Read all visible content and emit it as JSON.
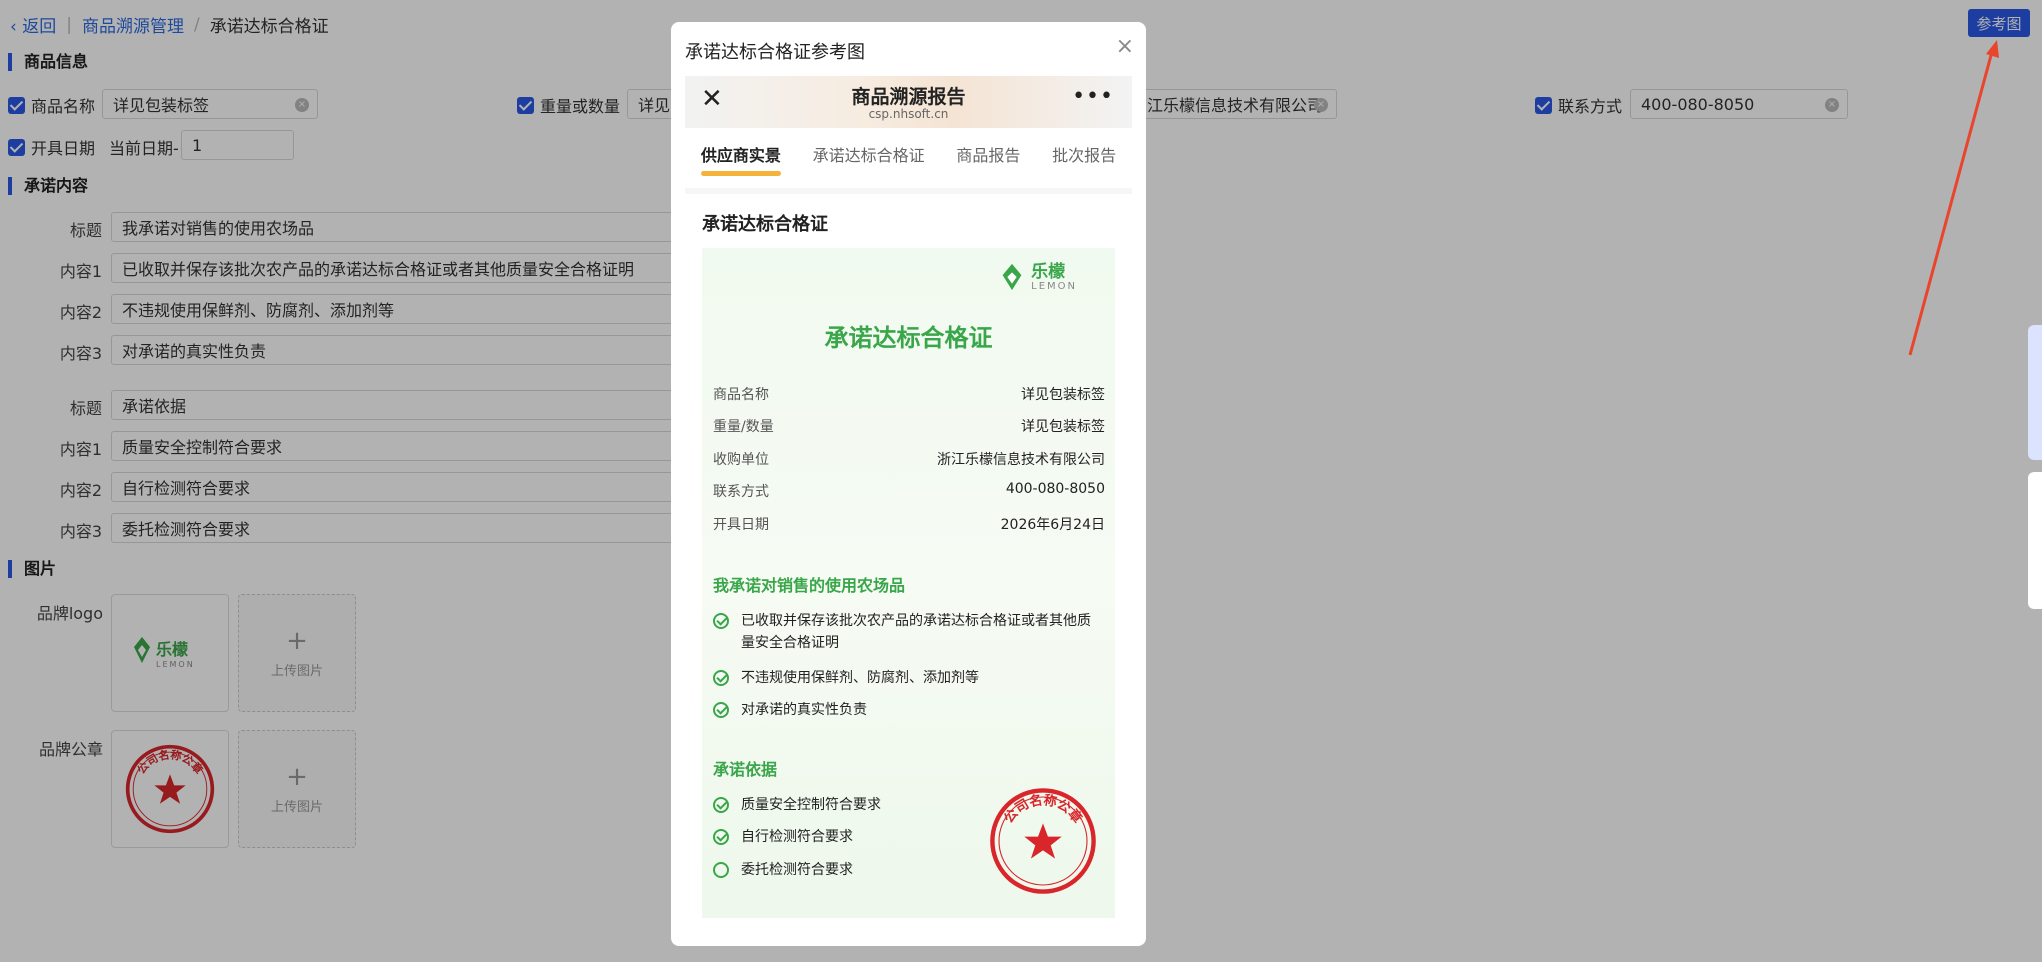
{
  "breadcrumb": {
    "back": "返回",
    "parent": "商品溯源管理",
    "current": "承诺达标合格证"
  },
  "ref_button": "参考图",
  "sections": {
    "product": "商品信息",
    "promise": "承诺内容",
    "images": "图片"
  },
  "product": {
    "name_label": "商品名称",
    "name_value": "详见包装标签",
    "weight_label": "重量或数量",
    "weight_value": "详见",
    "buyer_value": "江乐檬信息技术有限公司",
    "contact_label": "联系方式",
    "contact_value": "400-080-8050",
    "date_label": "开具日期",
    "date_prefix": "当前日期-",
    "date_offset": "1"
  },
  "promise": {
    "group1": [
      {
        "label": "标题",
        "value": "我承诺对销售的使用农场品"
      },
      {
        "label": "内容1",
        "value": "已收取并保存该批次农产品的承诺达标合格证或者其他质量安全合格证明"
      },
      {
        "label": "内容2",
        "value": "不违规使用保鲜剂、防腐剂、添加剂等"
      },
      {
        "label": "内容3",
        "value": "对承诺的真实性负责"
      }
    ],
    "group2": [
      {
        "label": "标题",
        "value": "承诺依据"
      },
      {
        "label": "内容1",
        "value": "质量安全控制符合要求"
      },
      {
        "label": "内容2",
        "value": "自行检测符合要求"
      },
      {
        "label": "内容3",
        "value": "委托检测符合要求"
      }
    ]
  },
  "images": {
    "logo_label": "品牌logo",
    "seal_label": "品牌公章",
    "upload_text": "上传图片",
    "plus": "+"
  },
  "brand": {
    "name": "乐檬",
    "en": "LEMON",
    "seal_text": "公司名称公章"
  },
  "modal": {
    "title": "承诺达标合格证参考图",
    "close": "×",
    "phone_title": "商品溯源报告",
    "phone_url": "csp.nhsoft.cn",
    "phone_close": "✕",
    "phone_more": "•••",
    "tabs": [
      "供应商实景",
      "承诺达标合格证",
      "商品报告",
      "批次报告"
    ],
    "section_title": "承诺达标合格证",
    "cert_title": "承诺达标合格证",
    "kv": [
      {
        "k": "商品名称",
        "v": "详见包装标签"
      },
      {
        "k": "重量/数量",
        "v": "详见包装标签"
      },
      {
        "k": "收购单位",
        "v": "浙江乐檬信息技术有限公司"
      },
      {
        "k": "联系方式",
        "v": "400-080-8050"
      },
      {
        "k": "开具日期",
        "v": "2026年6月24日"
      }
    ],
    "g1_title": "我承诺对销售的使用农场品",
    "g1": [
      "已收取并保存该批次农产品的承诺达标合格证或者其他质量安全合格证明",
      "不违规使用保鲜剂、防腐剂、添加剂等",
      "对承诺的真实性负责"
    ],
    "g2_title": "承诺依据",
    "g2": [
      "质量安全控制符合要求",
      "自行检测符合要求",
      "委托检测符合要求"
    ]
  },
  "colors": {
    "accent": "#2a5ae6",
    "green": "#3aa64a",
    "seal_red": "#d9262b",
    "arrow": "#e8452c"
  }
}
